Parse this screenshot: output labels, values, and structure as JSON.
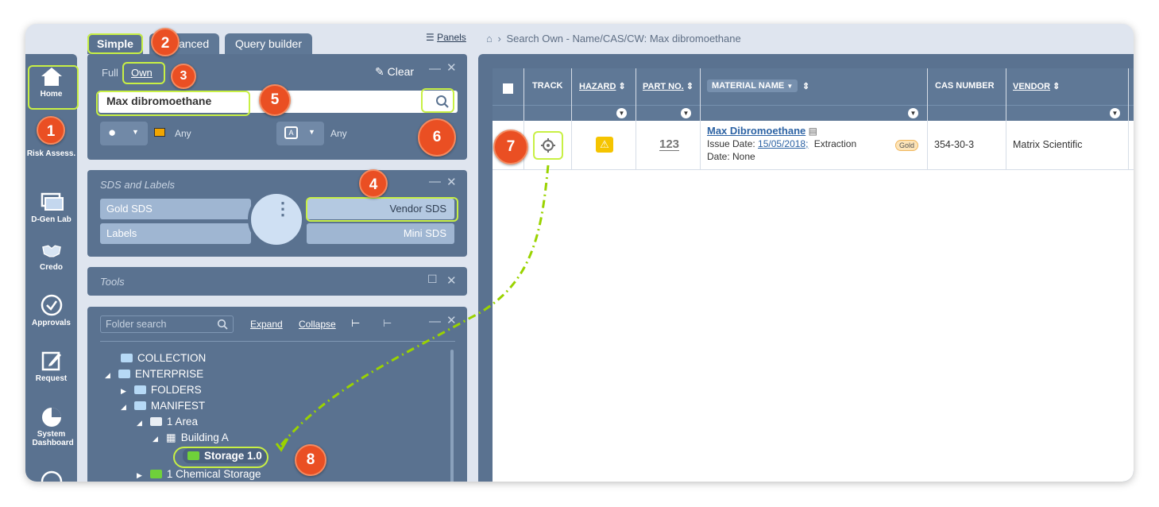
{
  "search": {
    "tabs": [
      "Simple",
      "Advanced",
      "Query builder"
    ],
    "panels_link": "Panels",
    "mode_full": "Full",
    "mode_own": "Own",
    "clear_label": "Clear",
    "query": "Max dibromoethane",
    "region_any": "Any",
    "language_any": "Any"
  },
  "breadcrumb": {
    "path": "Search Own - Name/CAS/CW: Max dibromoethane"
  },
  "nav": {
    "items": [
      {
        "label": "Home"
      },
      {
        "label": "Risk Assess."
      },
      {
        "label": "D-Gen Lab"
      },
      {
        "label": "Credo"
      },
      {
        "label": "Approvals"
      },
      {
        "label": "Request"
      },
      {
        "label": "System Dashboard"
      }
    ]
  },
  "sds_panel": {
    "title": "SDS and Labels",
    "gold_sds": "Gold SDS",
    "vendor_sds": "Vendor SDS",
    "labels": "Labels",
    "mini_sds": "Mini SDS"
  },
  "tools_panel": {
    "title": "Tools"
  },
  "folder_panel": {
    "search_placeholder": "Folder search",
    "expand": "Expand",
    "collapse": "Collapse",
    "tree": [
      "COLLECTION",
      "ENTERPRISE",
      "FOLDERS",
      "MANIFEST",
      "1 Area",
      "Building A",
      "Storage 1.0",
      "1 Chemical Storage"
    ]
  },
  "grid": {
    "headers": {
      "track": "TRACK",
      "hazard": "HAZARD",
      "part_no": "PART NO.",
      "material_name": "MATERIAL NAME",
      "cas_number": "CAS NUMBER",
      "vendor": "VENDOR"
    },
    "row": {
      "material": "Max Dibromoethane",
      "issue_label": "Issue Date:",
      "issue_date": "15/05/2018;",
      "extraction": "Extraction",
      "date_line": "Date: None",
      "gold_badge": "Gold",
      "part_icon_text": "123",
      "cas": "354-30-3",
      "vendor": "Matrix Scientific"
    }
  },
  "callouts": [
    "1",
    "2",
    "3",
    "4",
    "5",
    "6",
    "7",
    "8"
  ],
  "colors": {
    "panel": "#5a7290",
    "highlight": "#c8f044",
    "badge": "#ea4f23",
    "accent_link": "#2d63a4",
    "hazard": "#f5c400"
  }
}
